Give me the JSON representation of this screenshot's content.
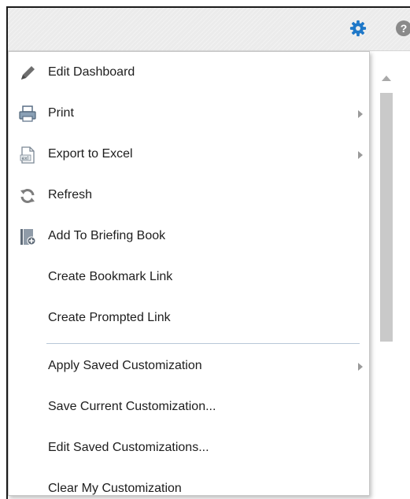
{
  "header": {
    "settings_icon": "gear-icon",
    "help_icon": "help-icon",
    "help_glyph": "?",
    "gear_color": "#1f78c8"
  },
  "menu": {
    "items": [
      {
        "label": "Edit Dashboard",
        "icon": "pencil-icon"
      },
      {
        "label": "Print",
        "icon": "printer-icon",
        "submenu": true
      },
      {
        "label": "Export to Excel",
        "icon": "excel-file-icon",
        "submenu": true
      },
      {
        "label": "Refresh",
        "icon": "refresh-icon"
      },
      {
        "label": "Add To Briefing Book",
        "icon": "briefing-book-icon"
      },
      {
        "label": "Create Bookmark Link"
      },
      {
        "label": "Create Prompted Link"
      },
      {
        "label": "Apply Saved Customization",
        "submenu": true
      },
      {
        "label": "Save Current Customization..."
      },
      {
        "label": "Edit Saved Customizations..."
      },
      {
        "label": "Clear My Customization"
      }
    ]
  }
}
